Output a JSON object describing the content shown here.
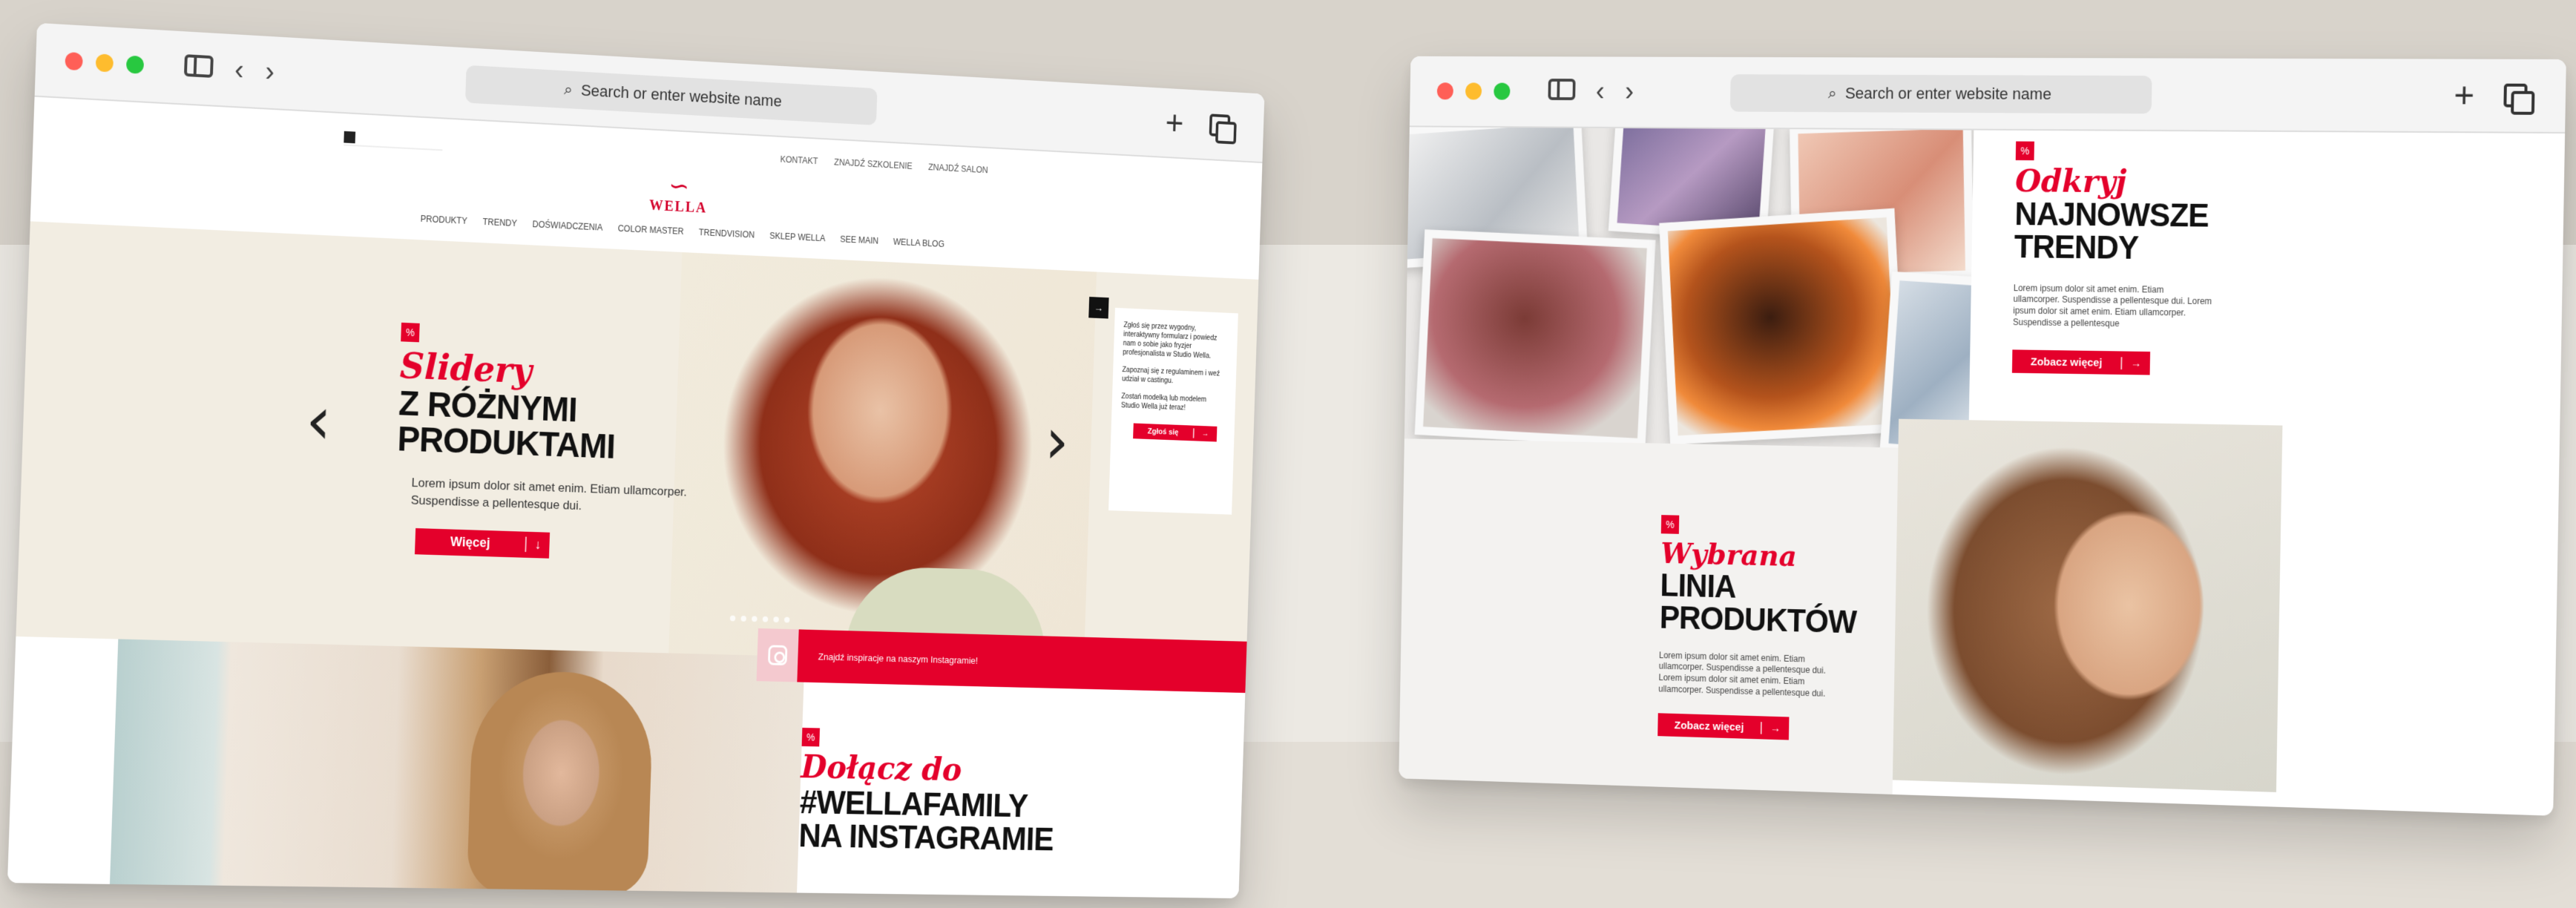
{
  "scene": {
    "colors": {
      "accent": "#e4002b",
      "backdrop": "#e8e4dd",
      "text": "#111111"
    }
  },
  "left_window": {
    "address_bar": {
      "placeholder": "Search or enter website name"
    },
    "topbar": {
      "links": [
        "KONTAKT",
        "ZNAJDŹ SZKOLENIE",
        "ZNAJDŹ SALON"
      ]
    },
    "logo": {
      "text": "WELLA"
    },
    "nav": [
      "PRODUKTY",
      "TRENDY",
      "DOŚWIADCZENIA",
      "COLOR MASTER",
      "TRENDVISION",
      "SKLEP WELLA",
      "SEE MAIN",
      "WELLA BLOG"
    ],
    "hero": {
      "script_title": "Slidery",
      "headline_line1": "Z RÓŻNYMI",
      "headline_line2": "PRODUKTAMI",
      "body": "Lorem ipsum dolor sit amet enim. Etiam ullamcorper. Suspendisse a pellentesque dui.",
      "button_label": "Więcej",
      "button_icon": "arrow-down-icon"
    },
    "side_panel": {
      "paragraph_1": "Zgłoś się przez wygodny, interaktywny formularz i powiedz nam o sobie jako fryzjer profesjonalista w Studio Wella.",
      "paragraph_2": "Zapoznaj się z regulaminem i weź udział w castingu.",
      "paragraph_3": "Zostań modelką lub modelem Studio Wella już teraz!",
      "button_label": "Zgłoś się"
    },
    "instagram_bar": {
      "text": "Znajdź inspiracje na naszym Instagramie!"
    },
    "instagram_section": {
      "script_title": "Dołącz do",
      "headline_line1": "#WELLAFAMILY",
      "headline_line2": "NA INSTAGRAMIE"
    }
  },
  "right_window": {
    "address_bar": {
      "placeholder": "Search or enter website name"
    },
    "trends": {
      "script_title": "Odkryj",
      "headline_line1": "NAJNOWSZE",
      "headline_line2": "TRENDY",
      "body": "Lorem ipsum dolor sit amet enim. Etiam ullamcorper. Suspendisse a pellentesque dui. Lorem ipsum dolor sit amet enim. Etiam ullamcorper. Suspendisse a pellentesque",
      "button_label": "Zobacz więcej"
    },
    "selected_line": {
      "script_title": "Wybrana",
      "headline_line1": "LINIA",
      "headline_line2": "PRODUKTÓW",
      "body": "Lorem ipsum dolor sit amet enim. Etiam ullamcorper. Suspendisse a pellentesque dui. Lorem ipsum dolor sit amet enim. Etiam ullamcorper. Suspendisse a pellentesque dui.",
      "button_label": "Zobacz więcej"
    }
  }
}
